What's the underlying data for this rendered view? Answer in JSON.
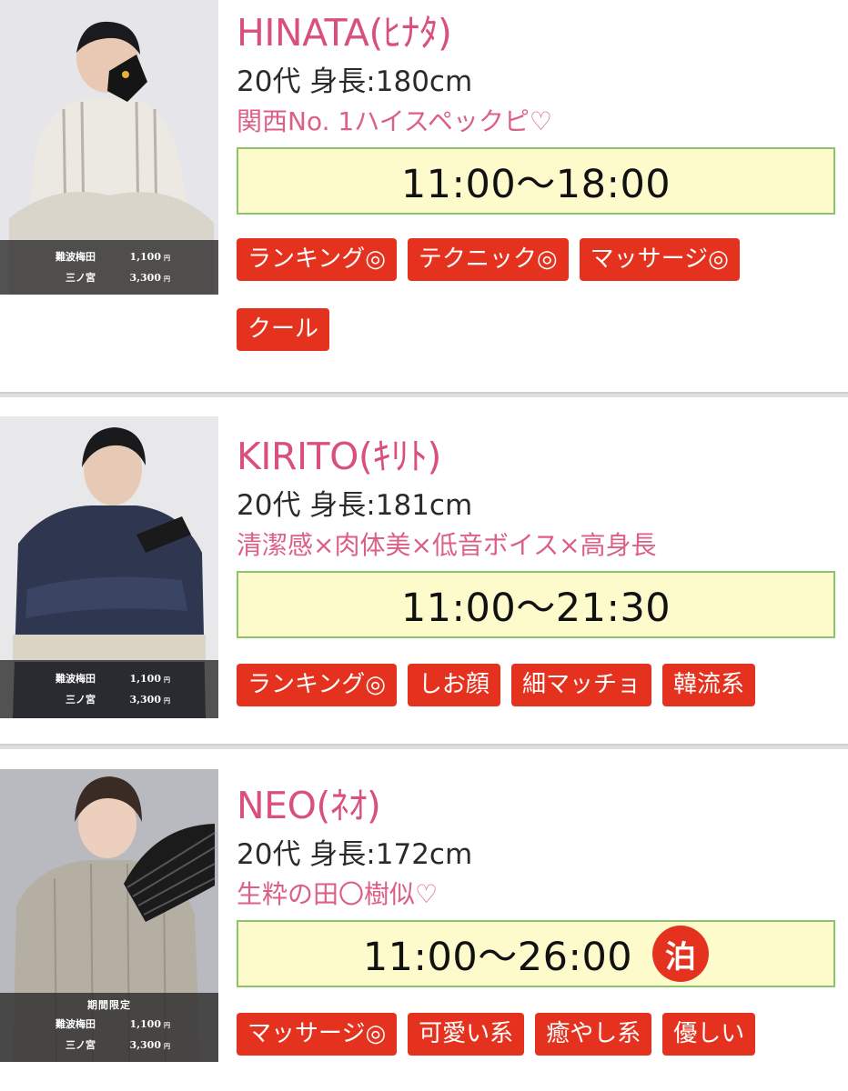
{
  "cast": [
    {
      "name": "HINATA(ﾋﾅﾀ)",
      "profile": "20代 身長:180cm",
      "catchphrase": "関西No. 1ハイスペックピ♡",
      "hours": "11:00〜18:00",
      "stay_badge": null,
      "tags": [
        "ランキング◎",
        "テクニック◎",
        "マッサージ◎",
        "クール"
      ],
      "photo": {
        "promo": null,
        "prices": [
          {
            "area": "難波梅田",
            "amount": "1,100",
            "unit": "円"
          },
          {
            "area": "三ノ宮",
            "amount": "3,300",
            "unit": "円"
          }
        ]
      }
    },
    {
      "name": "KIRITO(ｷﾘﾄ)",
      "profile": "20代 身長:181cm",
      "catchphrase": "清潔感×肉体美×低音ボイス×高身長",
      "hours": "11:00〜21:30",
      "stay_badge": null,
      "tags": [
        "ランキング◎",
        "しお顔",
        "細マッチョ",
        "韓流系"
      ],
      "photo": {
        "promo": null,
        "prices": [
          {
            "area": "難波梅田",
            "amount": "1,100",
            "unit": "円"
          },
          {
            "area": "三ノ宮",
            "amount": "3,300",
            "unit": "円"
          }
        ]
      }
    },
    {
      "name": "NEO(ﾈｵ)",
      "profile": "20代 身長:172cm",
      "catchphrase": "生粋の田〇樹似♡",
      "hours": "11:00〜26:00",
      "stay_badge": "泊",
      "tags": [
        "マッサージ◎",
        "可愛い系",
        "癒やし系",
        "優しい"
      ],
      "photo": {
        "promo": "期間限定",
        "prices": [
          {
            "area": "難波梅田",
            "amount": "1,100",
            "unit": "円"
          },
          {
            "area": "三ノ宮",
            "amount": "3,300",
            "unit": "円"
          }
        ]
      }
    }
  ],
  "colors": {
    "name": "#d9507f",
    "catchphrase": "#dc5f85",
    "tag_bg": "#e5321f",
    "hours_bg": "#fdfacb",
    "hours_border": "#8dc36d",
    "stay_badge": "#e4321f"
  },
  "icons": {
    "photo_placeholder": "person-silhouette-icon",
    "handheld_prop_1": "fox-mask-icon",
    "handheld_prop_2": "folding-fan-icon"
  }
}
